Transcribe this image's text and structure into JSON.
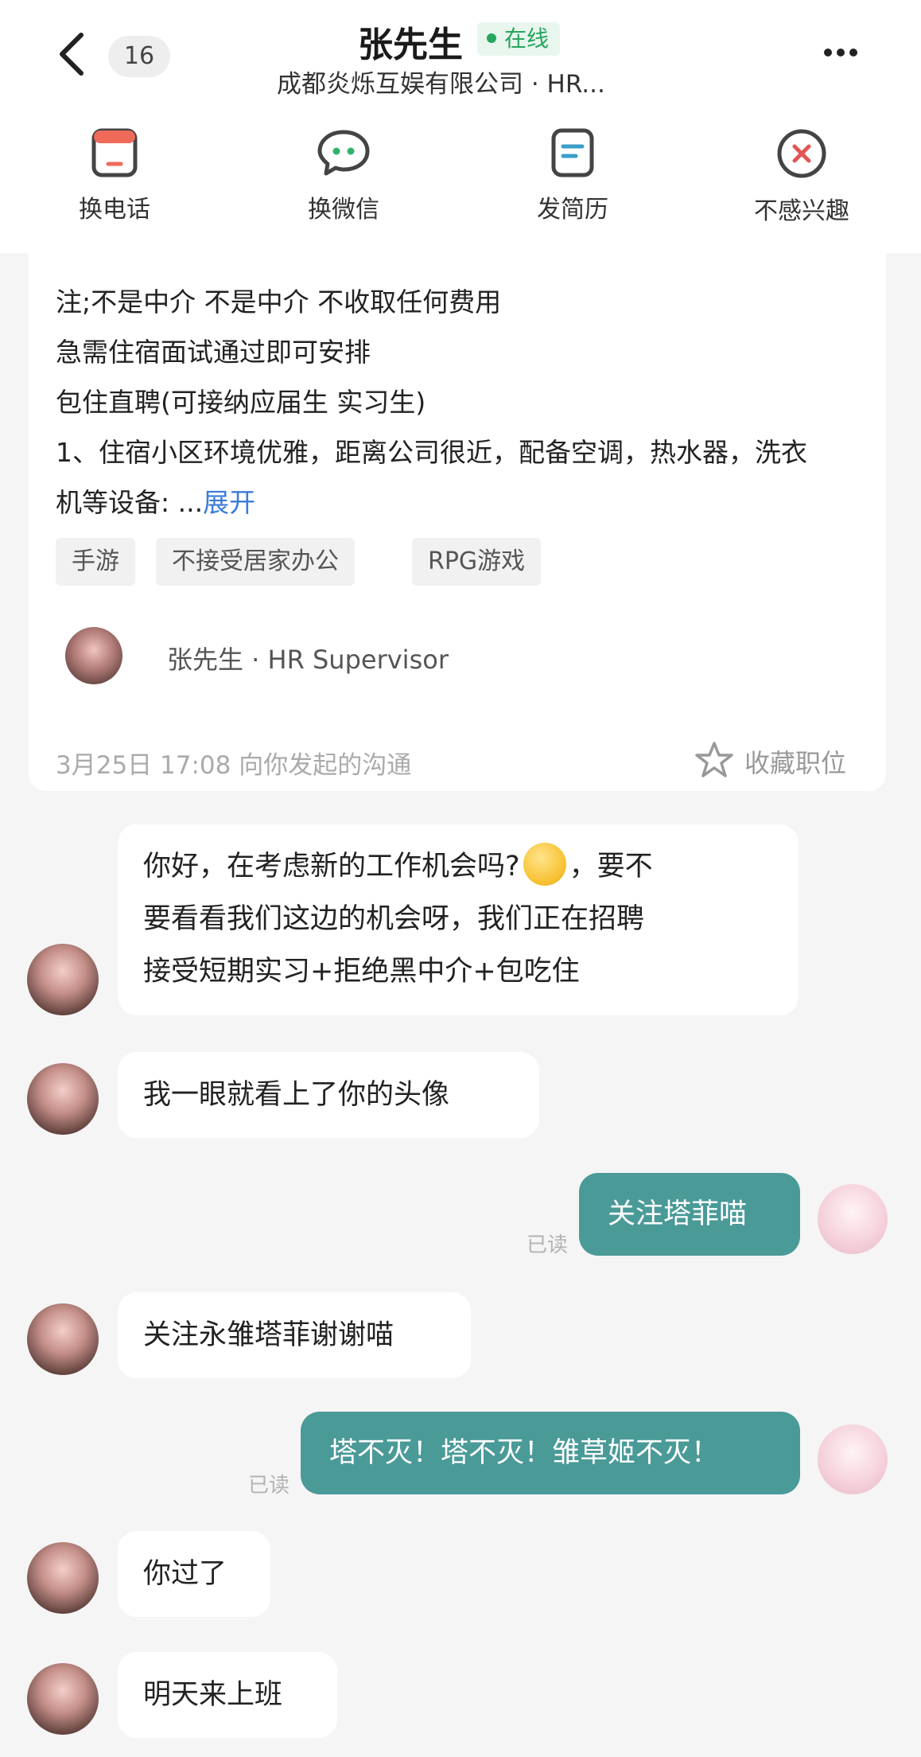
{
  "header": {
    "unread_count": "16",
    "contact_name": "张先生",
    "status": "在线",
    "company": "成都炎烁互娱有限公司 · HR..."
  },
  "actions": [
    {
      "label": "换电话",
      "icon": "phone-card-icon"
    },
    {
      "label": "换微信",
      "icon": "wechat-bubble-icon"
    },
    {
      "label": "发简历",
      "icon": "resume-icon"
    },
    {
      "label": "不感兴趣",
      "icon": "not-interested-icon"
    }
  ],
  "job_card": {
    "description_lines": [
      "注;不是中介  不是中介   不收取任何费用",
      "急需住宿面试通过即可安排",
      "包住直聘(可接纳应届生  实习生)",
      "1、住宿小区环境优雅，距离公司很近，配备空调，热水器，洗衣",
      "机等设备: ..."
    ],
    "expand_label": "展开",
    "tags": [
      "手游",
      "不接受居家办公",
      "RPG游戏"
    ],
    "poster": "张先生 · HR Supervisor",
    "timestamp": "3月25日 17:08 向你发起的沟通",
    "favorite_label": "收藏职位"
  },
  "messages": [
    {
      "from": "them",
      "lines": [
        "你好，在考虑新的工作机会吗?",
        "，要不",
        "要看看我们这边的机会呀，我们正在招聘",
        "接受短期实习+拒绝黑中介+包吃住"
      ]
    },
    {
      "from": "them",
      "text": "我一眼就看上了你的头像"
    },
    {
      "from": "me",
      "text": "关注塔菲喵",
      "status": "已读"
    },
    {
      "from": "them",
      "text": "关注永雏塔菲谢谢喵"
    },
    {
      "from": "me",
      "text": "塔不灭！塔不灭！雏草姬不灭！",
      "status": "已读"
    },
    {
      "from": "them",
      "text": "你过了"
    },
    {
      "from": "them",
      "text": "明天来上班"
    }
  ],
  "colors": {
    "accent_teal": "#4a9a98",
    "online_green": "#28a55f",
    "link_blue": "#3b7bd9",
    "background": "#f5f5f5"
  }
}
